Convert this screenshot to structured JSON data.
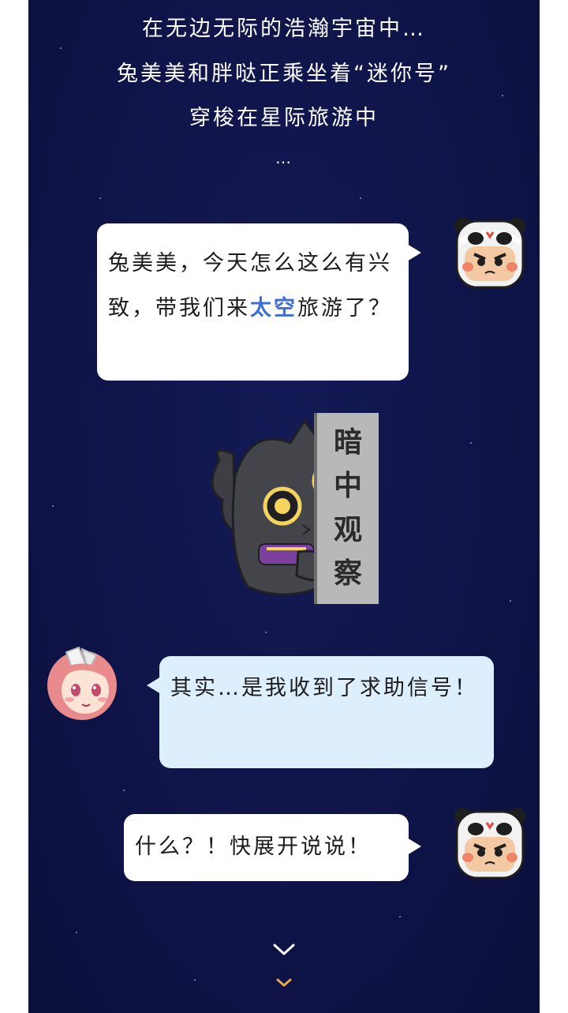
{
  "intro": {
    "line1": "在无边无际的浩瀚宇宙中…",
    "line2": "兔美美和胖哒正乘坐着“迷你号”",
    "line3": "穿梭在星际旅游中",
    "line4": "…"
  },
  "messages": [
    {
      "speaker": "panda",
      "text_before": "兔美美，今天怎么这么有兴致，带我们来",
      "highlight": "太空",
      "text_after": "旅游了？"
    },
    {
      "speaker": "rabbit",
      "text": "其实…是我收到了求助信号！"
    },
    {
      "speaker": "panda",
      "text": "什么？！快展开说说！"
    }
  ],
  "sticker": {
    "char1": "暗",
    "char2": "中",
    "char3": "观",
    "char4": "察"
  },
  "colors": {
    "background": "#0f1449",
    "bubble_white": "#ffffff",
    "bubble_blue": "#ddeefc",
    "highlight": "#3b6fd6",
    "chevron_white": "#ffffff",
    "chevron_gold": "#e8a94a"
  },
  "icons": {
    "scroll_hint_primary": "chevron-down-icon",
    "scroll_hint_secondary": "chevron-down-icon"
  }
}
